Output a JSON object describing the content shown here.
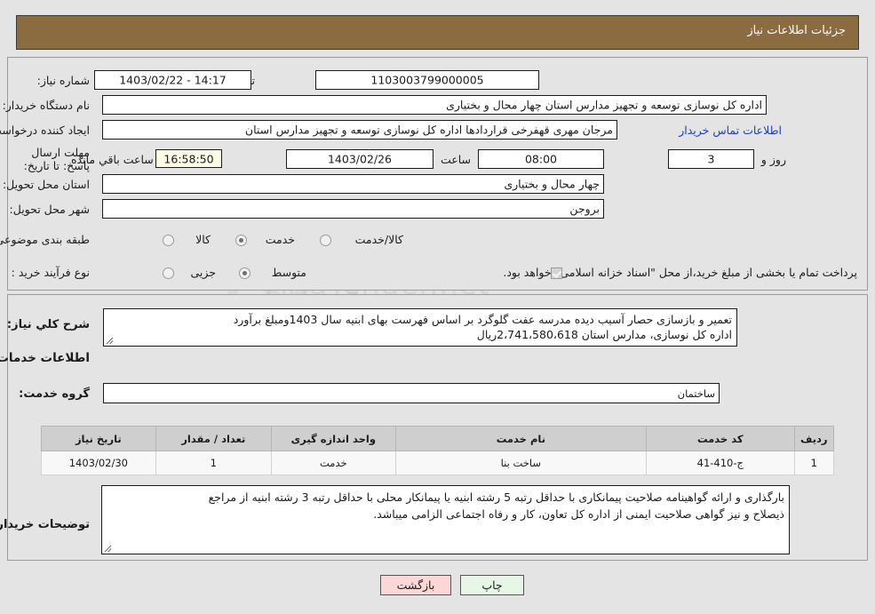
{
  "window": {
    "title": "جزئیات اطلاعات نیاز",
    "title_bar_color": "#8b6b40",
    "page_background": "#e4e4e4"
  },
  "watermark": {
    "text": "AriaTender.net",
    "brand": "V"
  },
  "need_info": {
    "need_number_label": "شماره نیاز:",
    "need_number_value": "1103003799000005",
    "announce_datetime_label": "تاریخ و ساعت اعلان عمومی:",
    "announce_datetime_value": "14:17 - 1403/02/22",
    "buyer_org_label": "نام دستگاه خریدار:",
    "buyer_org_value": "اداره کل نوسازی  توسعه و تجهیز مدارس استان چهار محال و بختیاری",
    "requester_label": "ایجاد کننده درخواست:",
    "requester_value": "مرجان مهری قهفرخی قراردادها اداره کل نوسازی  توسعه و تجهیز مدارس استان",
    "buyer_contact_link": "اطلاعات تماس خریدار",
    "deadline_label": "مهلت ارسال پاسخ: تا تاریخ:",
    "deadline_date": "1403/02/26",
    "deadline_hour_label": "ساعت",
    "deadline_hour": "08:00",
    "days_remaining": "3",
    "days_word": "روز و",
    "countdown": "16:58:50",
    "countdown_suffix": "ساعت باقي مانده",
    "province_label": "استان محل تحویل:",
    "province_value": "چهار محال و بختیاری",
    "city_label": "شهر محل تحویل:",
    "city_value": "بروجن",
    "category_label": "طبقه بندی موضوعی:",
    "category_options": [
      {
        "label": "کالا",
        "selected": false
      },
      {
        "label": "خدمت",
        "selected": true
      },
      {
        "label": "کالا/خدمت",
        "selected": false
      }
    ],
    "process_label": "نوع فرآیند خرید :",
    "process_options": [
      {
        "label": "جزیی",
        "selected": false
      },
      {
        "label": "متوسط",
        "selected": true
      }
    ],
    "treasury_checkbox_checked": true,
    "treasury_text": "پرداخت تمام یا بخشی از مبلغ خرید،از محل \"اسناد خزانه اسلامی\" خواهد بود."
  },
  "summary": {
    "label": "شرح کلي نياز:",
    "line1": "تعمیر و بازسازی حصار آسیب دیده مدرسه عفت گلوگرد بر اساس فهرست بهای ابنیه سال 1403ومبلغ برآورد",
    "line2": "اداره کل نوسازی،  مدارس استان 2،741،580،618ریال"
  },
  "service_section": {
    "heading": "اطلاعات خدمات مورد نیاز",
    "group_label": "گروه خدمت:",
    "group_value": "ساختمان"
  },
  "table": {
    "columns": [
      "ردیف",
      "کد خدمت",
      "نام خدمت",
      "واحد اندازه گیری",
      "تعداد / مقدار",
      "تاریخ نیاز"
    ],
    "rows": [
      {
        "row_no": "1",
        "service_code": "ج-410-41",
        "service_name": "ساخت بنا",
        "unit": "خدمت",
        "quantity": "1",
        "need_date": "1403/02/30"
      }
    ]
  },
  "buyer_notes": {
    "label": "توضیحات خریدار:",
    "line1": "بارگذاری و ارائه گواهینامه صلاحیت پیمانکاری با حداقل رتبه 5 رشته ابنیه یا پیمانکار محلی با حداقل رتبه 3 رشته ابنیه از مراجع",
    "line2": "ذیصلاح و نیز گواهی صلاحیت ایمنی از اداره کل تعاون، کار و رفاه اجتماعی الزامی میباشد."
  },
  "footer": {
    "print_label": "چاپ",
    "back_label": "بازگشت"
  }
}
